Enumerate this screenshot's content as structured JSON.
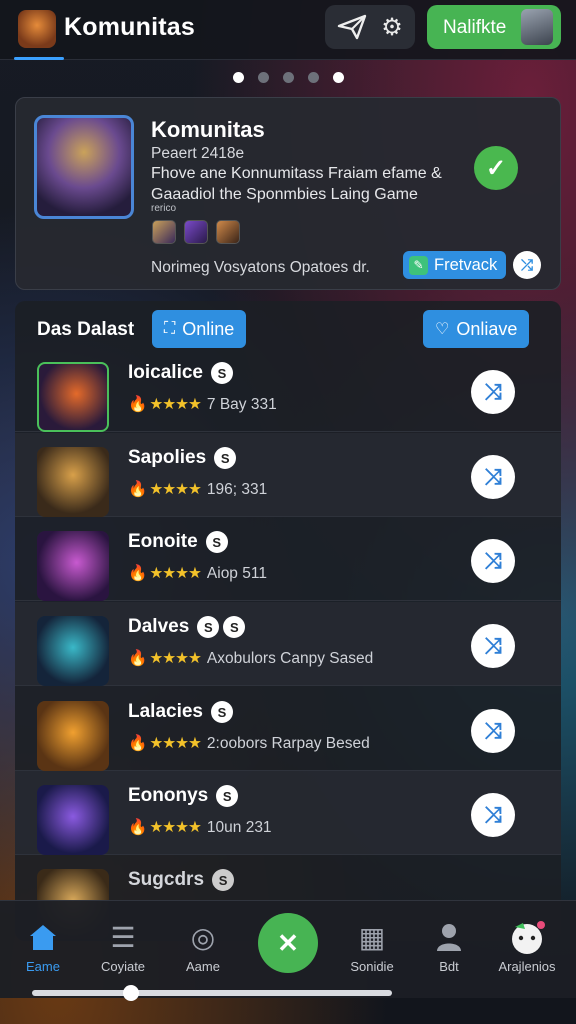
{
  "header": {
    "title": "Komunitas",
    "cta_label": "Nalifkte",
    "send_icon": "paper-plane-icon",
    "settings_icon": "gear-icon"
  },
  "carousel": {
    "count": 5,
    "active_indices": [
      0,
      4
    ]
  },
  "featured": {
    "title": "Komunitas",
    "subtitle": "Peaert 2418e",
    "description": "Fhove ane Konnumitass Fraiam efame & Gaaadiol the Sponmbies Laing Game",
    "small_label": "rerico",
    "footer": "Norimeg Vosyatons Opatoes dr.",
    "feedback_label": "Fretvack",
    "status": "verified"
  },
  "list": {
    "title": "Das Dalast",
    "filter_left": "Online",
    "filter_right": "Onliave",
    "items": [
      {
        "name": "Ioicalice",
        "badges": [
          "S"
        ],
        "meta": "7 Bay 331",
        "stars": 4
      },
      {
        "name": "Sapolies",
        "badges": [
          "S"
        ],
        "meta": "196; 331",
        "stars": 4
      },
      {
        "name": "Eonoite",
        "badges": [
          "S"
        ],
        "meta": "Aiop 511",
        "stars": 4
      },
      {
        "name": "Dalves",
        "badges": [
          "S",
          "S"
        ],
        "meta": "Axobulors Canpy Sased",
        "stars": 4
      },
      {
        "name": "Lalacies",
        "badges": [
          "S"
        ],
        "meta": "2:oobors Rarpay Besed",
        "stars": 4
      },
      {
        "name": "Eononys",
        "badges": [
          "S"
        ],
        "meta": "10un 231",
        "stars": 4
      },
      {
        "name": "Sugcdrs",
        "badges": [
          "S"
        ],
        "meta": "",
        "stars": 0
      }
    ]
  },
  "nav": {
    "items": [
      {
        "label": "Eame",
        "icon": "home-icon"
      },
      {
        "label": "Coyiate",
        "icon": "menu-icon"
      },
      {
        "label": "Aame",
        "icon": "disc-icon"
      },
      {
        "label": "Sonidie",
        "icon": "film-icon"
      },
      {
        "label": "Bdt",
        "icon": "user-icon"
      },
      {
        "label": "Arajlenios",
        "icon": "mascot-icon"
      }
    ],
    "center_icon": "shuffle-icon",
    "scroll_fraction": 0.34
  },
  "colors": {
    "accent": "#2f8fe0",
    "green": "#47b453",
    "star": "#f3c22a"
  }
}
